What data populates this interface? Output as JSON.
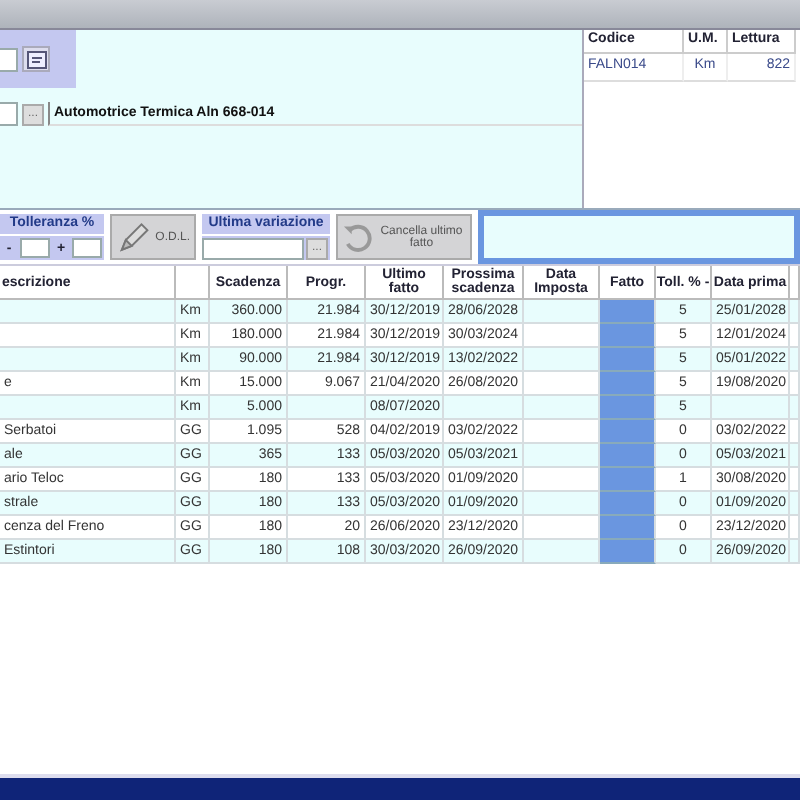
{
  "vehicle_lookup": {
    "button": "...",
    "description": "Automotrice Termica Aln 668-014"
  },
  "readings": {
    "columns": [
      "Codice",
      "U.M.",
      "Lettura"
    ],
    "rows": [
      [
        "FALN014",
        "Km",
        "822"
      ]
    ]
  },
  "toolbar": {
    "tolerance": {
      "label": "Tolleranza %",
      "minus": "-",
      "plus": "+"
    },
    "odl_button": "O.D.L.",
    "last_change": {
      "label": "Ultima variazione",
      "button": "..."
    },
    "undo_button": "Cancella ultimo fatto"
  },
  "schedule": {
    "columns": [
      "escrizione",
      "",
      "Scadenza",
      "Progr.",
      "Ultimo fatto",
      "Prossima scadenza",
      "Data Imposta",
      "Fatto",
      "Toll. % -",
      "Data prima"
    ],
    "rows": [
      [
        "",
        "Km",
        "360.000",
        "21.984",
        "30/12/2019",
        "28/06/2028",
        "",
        "",
        "5",
        "25/01/2028"
      ],
      [
        "",
        "Km",
        "180.000",
        "21.984",
        "30/12/2019",
        "30/03/2024",
        "",
        "",
        "5",
        "12/01/2024"
      ],
      [
        "",
        "Km",
        "90.000",
        "21.984",
        "30/12/2019",
        "13/02/2022",
        "",
        "",
        "5",
        "05/01/2022"
      ],
      [
        "e",
        "Km",
        "15.000",
        "9.067",
        "21/04/2020",
        "26/08/2020",
        "",
        "",
        "5",
        "19/08/2020"
      ],
      [
        "",
        "Km",
        "5.000",
        "",
        "08/07/2020",
        "",
        "",
        "",
        "5",
        ""
      ],
      [
        "Serbatoi",
        "GG",
        "1.095",
        "528",
        "04/02/2019",
        "03/02/2022",
        "",
        "",
        "0",
        "03/02/2022"
      ],
      [
        "ale",
        "GG",
        "365",
        "133",
        "05/03/2020",
        "05/03/2021",
        "",
        "",
        "0",
        "05/03/2021"
      ],
      [
        "ario Teloc",
        "GG",
        "180",
        "133",
        "05/03/2020",
        "01/09/2020",
        "",
        "",
        "1",
        "30/08/2020"
      ],
      [
        "strale",
        "GG",
        "180",
        "133",
        "05/03/2020",
        "01/09/2020",
        "",
        "",
        "0",
        "01/09/2020"
      ],
      [
        "cenza del Freno",
        "GG",
        "180",
        "20",
        "26/06/2020",
        "23/12/2020",
        "",
        "",
        "0",
        "23/12/2020"
      ],
      [
        "Estintori",
        "GG",
        "180",
        "108",
        "30/03/2020",
        "26/09/2020",
        "",
        "",
        "0",
        "26/09/2020"
      ]
    ]
  }
}
